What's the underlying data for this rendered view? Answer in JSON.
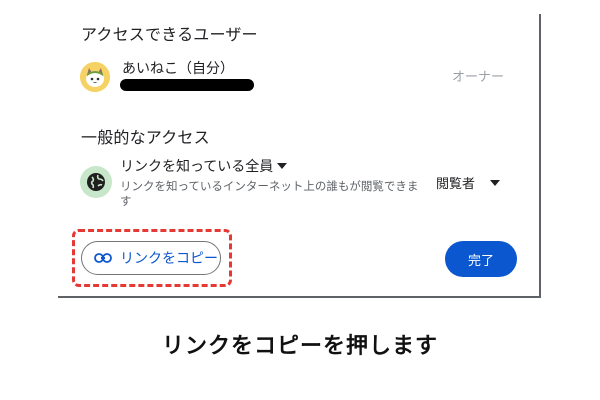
{
  "dialog": {
    "users_section_title": "アクセスできるユーザー",
    "owner": {
      "name": "あいねこ（自分）",
      "role": "オーナー",
      "avatar_icon": "cat-avatar-icon"
    },
    "general_access_title": "一般的なアクセス",
    "general_access": {
      "scope": "リンクを知っている全員",
      "description": "リンクを知っているインターネット上の誰もが閲覧できます",
      "role": "閲覧者",
      "icon": "globe-icon"
    },
    "copy_link_label": "リンクをコピー",
    "done_label": "完了"
  },
  "caption": "リンクをコピーを押します",
  "colors": {
    "primary": "#0b57d0",
    "highlight": "#e53935",
    "globe_bg": "#c8e6c9"
  }
}
